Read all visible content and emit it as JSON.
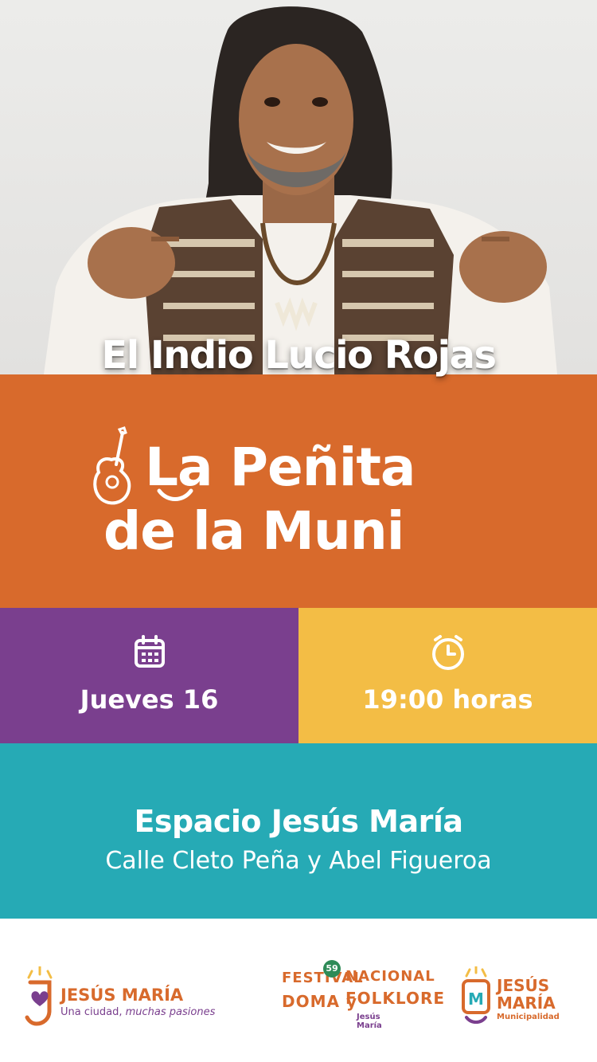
{
  "artist": {
    "name": "El Indio Lucio Rojas"
  },
  "event": {
    "title_line1": "La Peñita",
    "title_line2": "de la Muni"
  },
  "date": {
    "icon": "calendar-icon",
    "label": "Jueves 16"
  },
  "time": {
    "icon": "clock-icon",
    "label": "19:00 horas"
  },
  "venue": {
    "name": "Espacio Jesús María",
    "address": "Calle Cleto Peña y Abel Figueroa"
  },
  "footer": {
    "logo_left": {
      "name": "JESÚS MARÍA",
      "tagline_plain": "Una ciudad,",
      "tagline_italic": "muchas pasiones"
    },
    "logo_middle": {
      "line1a": "FESTIVAL",
      "line1b": "NACIONAL",
      "number": "59",
      "line2a": "DOMA y",
      "line2b": "FOLKLORE",
      "city": "Jesús María"
    },
    "logo_right": {
      "line1": "JESÚS",
      "line2": "MARÍA",
      "subtitle": "Municipalidad"
    }
  },
  "colors": {
    "orange": "#d86a2c",
    "purple": "#7a3f8e",
    "yellow": "#f3bd45",
    "teal": "#26aab5"
  }
}
